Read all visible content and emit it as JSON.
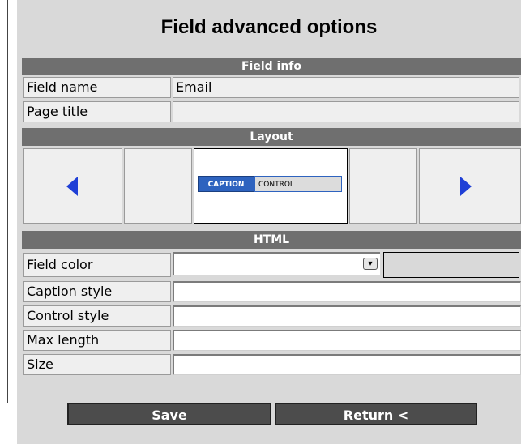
{
  "title": "Field advanced options",
  "sections": {
    "field_info": "Field info",
    "layout": "Layout",
    "html": "HTML"
  },
  "field_info": {
    "field_name_label": "Field name",
    "field_name_value": "Email",
    "page_title_label": "Page title",
    "page_title_value": ""
  },
  "layout": {
    "preview_caption": "CAPTION",
    "preview_control": "CONTROL",
    "prev_icon": "triangle-left-icon",
    "next_icon": "triangle-right-icon"
  },
  "html": {
    "field_color_label": "Field color",
    "field_color_value": "",
    "caption_style_label": "Caption style",
    "caption_style_value": "",
    "control_style_label": "Control style",
    "control_style_value": "",
    "max_length_label": "Max length",
    "max_length_value": "",
    "size_label": "Size",
    "size_value": ""
  },
  "buttons": {
    "save": "Save",
    "return": "Return <"
  },
  "colors": {
    "section_header": "#6f6f6f",
    "arrow_blue": "#1f3fd6",
    "caption_blue": "#2e63bf"
  }
}
